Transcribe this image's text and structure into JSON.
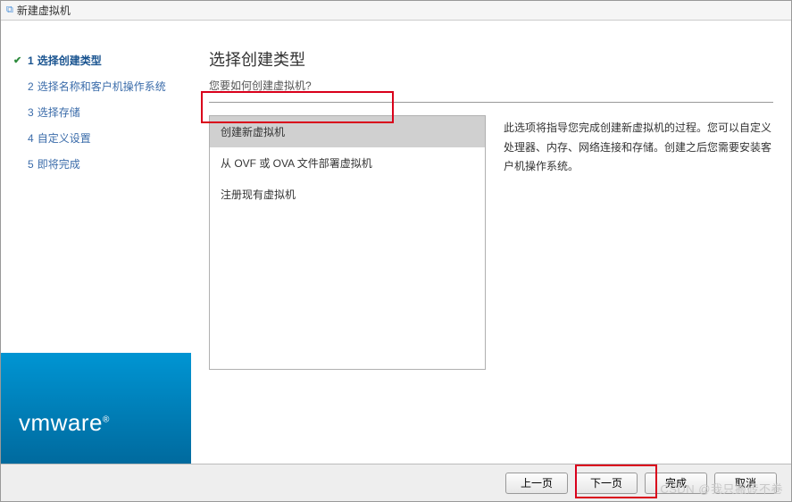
{
  "window": {
    "title": "新建虚拟机"
  },
  "sidebar": {
    "steps": [
      {
        "num": "1",
        "label": "选择创建类型",
        "active": true,
        "checked": true
      },
      {
        "num": "2",
        "label": "选择名称和客户机操作系统",
        "active": false,
        "checked": false
      },
      {
        "num": "3",
        "label": "选择存储",
        "active": false,
        "checked": false
      },
      {
        "num": "4",
        "label": "自定义设置",
        "active": false,
        "checked": false
      },
      {
        "num": "5",
        "label": "即将完成",
        "active": false,
        "checked": false
      }
    ],
    "logo": "vmware",
    "logo_reg": "®"
  },
  "content": {
    "title": "选择创建类型",
    "subtitle": "您要如何创建虚拟机?",
    "options": [
      {
        "label": "创建新虚拟机",
        "selected": true
      },
      {
        "label": "从 OVF 或 OVA 文件部署虚拟机",
        "selected": false
      },
      {
        "label": "注册现有虚拟机",
        "selected": false
      }
    ],
    "description": "此选项将指导您完成创建新虚拟机的过程。您可以自定义处理器、内存、网络连接和存储。创建之后您需要安装客户机操作系统。"
  },
  "footer": {
    "back": "上一页",
    "next": "下一页",
    "finish": "完成",
    "cancel": "取消"
  },
  "watermark": "CSDN @我只搬砖不卷"
}
